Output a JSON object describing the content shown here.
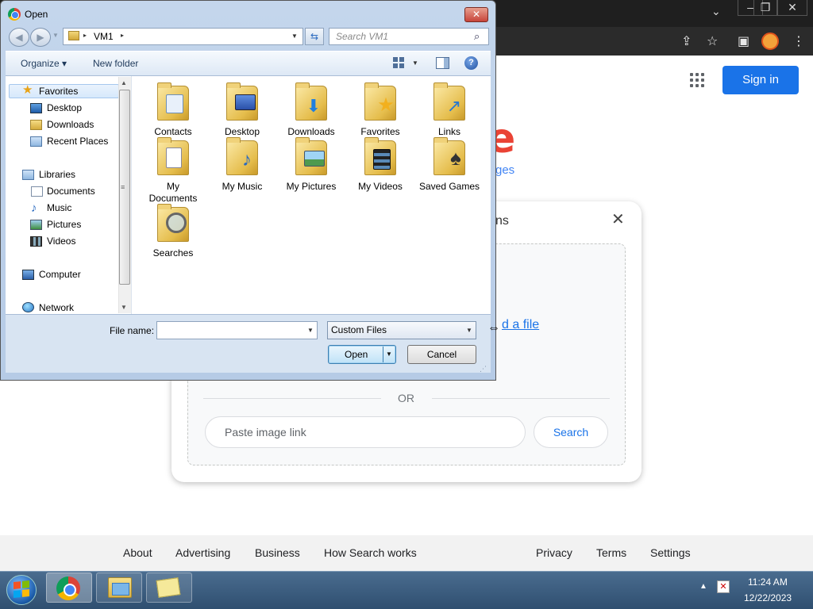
{
  "browser": {
    "window_controls": [
      "–",
      "❐",
      "✕"
    ],
    "sign_in_label": "Sign in",
    "logo_fragment": "e",
    "images_fragment": "ges",
    "lens": {
      "title_fragment": "ns",
      "close_glyph": "✕",
      "upload_link_fragment": "d a file",
      "or_text": "OR",
      "paste_placeholder": "Paste image link",
      "search_label": "Search"
    },
    "footer": {
      "left_links": [
        "About",
        "Advertising",
        "Business",
        "How Search works"
      ],
      "right_links": [
        "Privacy",
        "Terms",
        "Settings"
      ]
    }
  },
  "dialog": {
    "title": "Open",
    "close_glyph": "✕",
    "address": {
      "path": "VM1",
      "separator": "▸"
    },
    "search_placeholder": "Search VM1",
    "toolbar": {
      "organize_label": "Organize ▾",
      "new_folder_label": "New folder",
      "help_glyph": "?"
    },
    "nav": {
      "favorites": {
        "label": "Favorites",
        "items": [
          "Desktop",
          "Downloads",
          "Recent Places"
        ]
      },
      "libraries": {
        "label": "Libraries",
        "items": [
          "Documents",
          "Music",
          "Pictures",
          "Videos"
        ]
      },
      "computer_label": "Computer",
      "network_label": "Network"
    },
    "folders": [
      {
        "label": "Contacts",
        "icon": "contacts-icon"
      },
      {
        "label": "Desktop",
        "icon": "desktop-folder-icon"
      },
      {
        "label": "Downloads",
        "icon": "downloads-folder-icon"
      },
      {
        "label": "Favorites",
        "icon": "favorites-folder-icon"
      },
      {
        "label": "Links",
        "icon": "links-folder-icon"
      },
      {
        "label": "My Documents",
        "icon": "documents-folder-icon"
      },
      {
        "label": "My Music",
        "icon": "music-folder-icon"
      },
      {
        "label": "My Pictures",
        "icon": "pictures-folder-icon"
      },
      {
        "label": "My Videos",
        "icon": "videos-folder-icon"
      },
      {
        "label": "Saved Games",
        "icon": "saved-games-folder-icon"
      },
      {
        "label": "Searches",
        "icon": "searches-folder-icon"
      }
    ],
    "file_name_label": "File name:",
    "file_name_value": "",
    "file_type_value": "Custom Files",
    "open_label": "Open",
    "cancel_label": "Cancel"
  },
  "taskbar": {
    "time": "11:24 AM",
    "date": "12/22/2023"
  },
  "colors": {
    "sign_in_blue": "#1a73e8",
    "dialog_frame": "#b6cbe6",
    "taskbar": "#2f4f70"
  }
}
